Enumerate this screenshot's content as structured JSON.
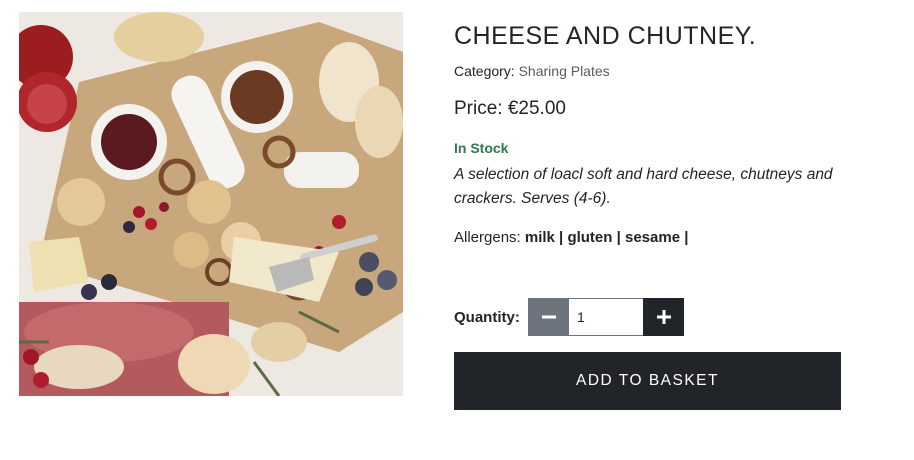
{
  "product": {
    "title": "CHEESE AND CHUTNEY.",
    "category_label": "Category:",
    "category_value": "Sharing Plates",
    "price_label": "Price:",
    "price_value": "€25.00",
    "stock_status": "In Stock",
    "description": "A selection of loacl soft and hard cheese, chutneys and crackers. Serves (4-6).",
    "allergens_label": "Allergens:",
    "allergens": [
      "milk",
      "gluten",
      "sesame"
    ],
    "image_alt": "charcuterie board with cheese, chutney, crackers, pretzels and fruit"
  },
  "quantity": {
    "label": "Quantity:",
    "value": "1",
    "decrement_icon": "minus-icon",
    "increment_icon": "plus-icon"
  },
  "actions": {
    "add_to_basket": "ADD TO BASKET"
  },
  "colors": {
    "primary_dark": "#212529",
    "secondary_grey": "#6c757d",
    "in_stock_green": "#2f7a4f",
    "category_link": "#555b61"
  }
}
